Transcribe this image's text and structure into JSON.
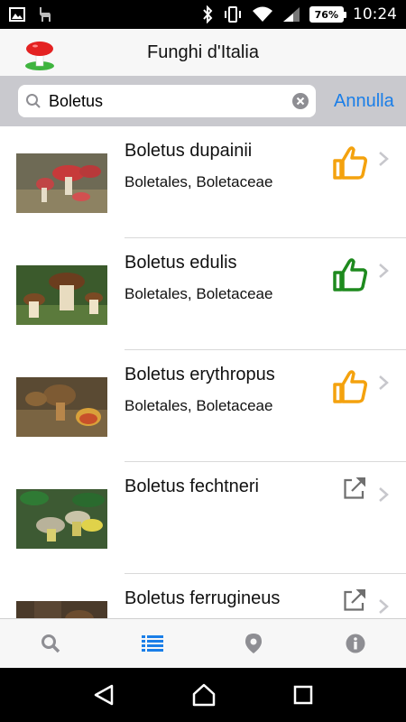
{
  "status_bar": {
    "battery": "76%",
    "time": "10:24"
  },
  "app": {
    "title": "Funghi d'Italia"
  },
  "search": {
    "value": "Boletus",
    "cancel_label": "Annulla"
  },
  "list": [
    {
      "name": "Boletus dupainii",
      "family": "Boletales, Boletaceae",
      "status": "thumb-up-icon",
      "status_color": "#f4a20e"
    },
    {
      "name": "Boletus edulis",
      "family": "Boletales, Boletaceae",
      "status": "thumb-up-icon",
      "status_color": "#1e8a1e"
    },
    {
      "name": "Boletus erythropus",
      "family": "Boletales, Boletaceae",
      "status": "thumb-up-icon",
      "status_color": "#f4a20e"
    },
    {
      "name": "Boletus fechtneri",
      "family": "",
      "status": "external-link-icon",
      "status_color": "#6f6f6f"
    },
    {
      "name": "Boletus ferrugineus",
      "family": "",
      "status": "external-link-icon",
      "status_color": "#6f6f6f"
    }
  ],
  "tabs": [
    {
      "icon": "search-icon",
      "active": false
    },
    {
      "icon": "list-icon",
      "active": true
    },
    {
      "icon": "location-pin-icon",
      "active": false
    },
    {
      "icon": "info-icon",
      "active": false
    }
  ],
  "colors": {
    "accent": "#1a7ee8",
    "tab_inactive": "#8e8e93"
  }
}
